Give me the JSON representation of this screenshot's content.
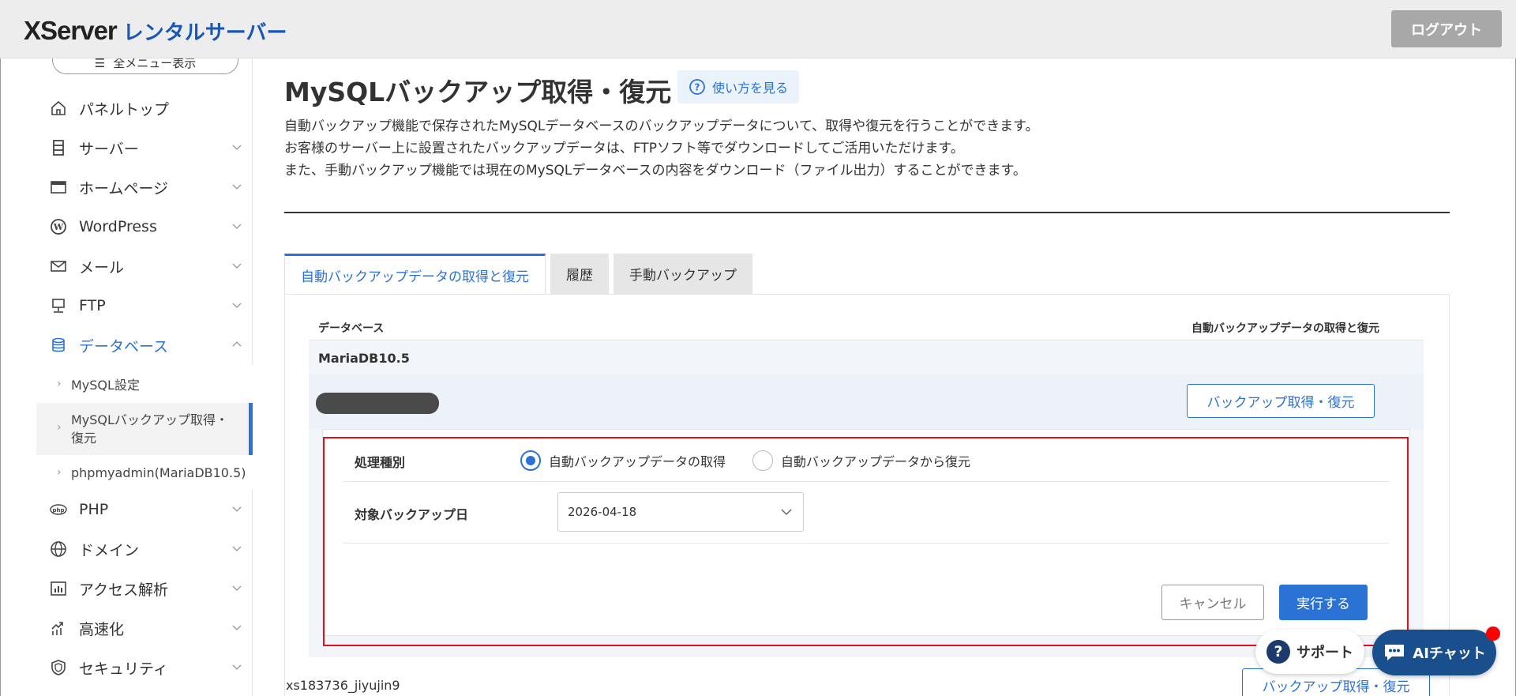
{
  "header": {
    "logo_main": "XServer",
    "logo_sub": "レンタルサーバー",
    "logout_label": "ログアウト"
  },
  "sidebar": {
    "all_menu_label": "全メニュー表示",
    "items": [
      {
        "label": "パネルトップ",
        "icon": "home-icon"
      },
      {
        "label": "サーバー",
        "icon": "server-icon"
      },
      {
        "label": "ホームページ",
        "icon": "browser-icon"
      },
      {
        "label": "WordPress",
        "icon": "wordpress-icon"
      },
      {
        "label": "メール",
        "icon": "mail-icon"
      },
      {
        "label": "FTP",
        "icon": "ftp-icon"
      },
      {
        "label": "データベース",
        "icon": "database-icon"
      },
      {
        "label": "PHP",
        "icon": "php-icon"
      },
      {
        "label": "ドメイン",
        "icon": "globe-icon"
      },
      {
        "label": "アクセス解析",
        "icon": "chart-icon"
      },
      {
        "label": "高速化",
        "icon": "speed-icon"
      },
      {
        "label": "セキュリティ",
        "icon": "shield-icon"
      }
    ],
    "sub_items": [
      {
        "label": "MySQL設定"
      },
      {
        "label": "MySQLバックアップ取得・復元"
      },
      {
        "label": "phpmyadmin(MariaDB10.5)"
      }
    ]
  },
  "main": {
    "title": "MySQLバックアップ取得・復元",
    "howto_label": "使い方を見る",
    "desc_lines": [
      "自動バックアップ機能で保存されたMySQLデータベースのバックアップデータについて、取得や復元を行うことができます。",
      "お客様のサーバー上に設置されたバックアップデータは、FTPソフト等でダウンロードしてご活用いただけます。",
      "また、手動バックアップ機能では現在のMySQLデータベースの内容をダウンロード（ファイル出力）することができます。"
    ],
    "tabs": [
      {
        "label": "自動バックアップデータの取得と復元",
        "active": true
      },
      {
        "label": "履歴",
        "active": false
      },
      {
        "label": "手動バックアップ",
        "active": false
      }
    ],
    "table": {
      "col_database": "データベース",
      "col_action": "自動バックアップデータの取得と復元"
    },
    "db_group": "MariaDB10.5",
    "backup_button": "バックアップ取得・復元",
    "form": {
      "type_label": "処理種別",
      "radio_get": "自動バックアップデータの取得",
      "radio_restore": "自動バックアップデータから復元",
      "selected_radio": "get",
      "date_label": "対象バックアップ日",
      "date_value": "2026-04-18",
      "cancel_label": "キャンセル",
      "exec_label": "実行する"
    },
    "second_db": {
      "name": "xs183736_jiyujin9",
      "button": "バックアップ取得・復元"
    }
  },
  "floating": {
    "support_label": "サポート",
    "ai_label": "AIチャット"
  },
  "colors": {
    "accent": "#2a72d4",
    "highlight_border": "#e0101c",
    "ai_chat_bg": "#1a4f8e"
  }
}
